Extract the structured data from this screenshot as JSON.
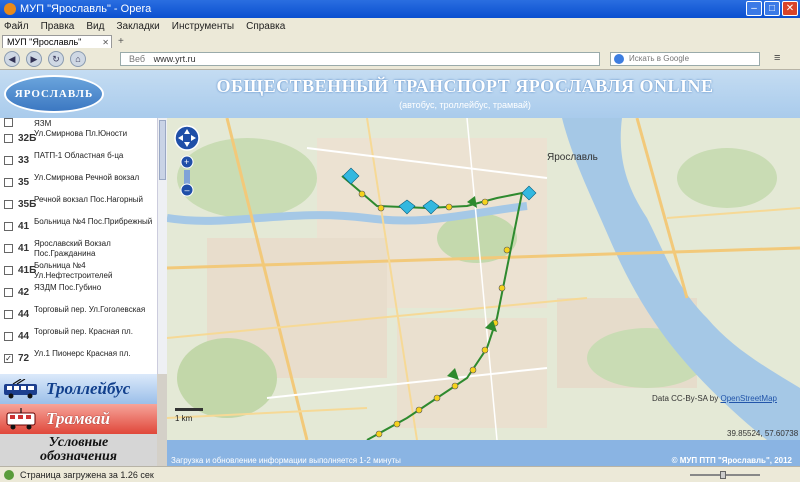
{
  "window": {
    "title": "МУП \"Ярославль\" - Opera"
  },
  "menu": [
    "Файл",
    "Правка",
    "Вид",
    "Закладки",
    "Инструменты",
    "Справка"
  ],
  "tab": {
    "label": "МУП \"Ярославль\""
  },
  "address_bar": {
    "prefix": "Веб",
    "url": "www.yrt.ru"
  },
  "search_bar": {
    "placeholder": "Искать в Google"
  },
  "header": {
    "logo": "ЯРОСЛАВЛЬ",
    "title": "ОБЩЕСТВЕННЫЙ ТРАНСПОРТ ЯРОСЛАВЛЯ ONLINE",
    "subtitle": "(автобус, троллейбус, трамвай)"
  },
  "routes": [
    {
      "num": "",
      "name": "ЯЗМ",
      "checked": false
    },
    {
      "num": "32Б",
      "name": "Ул.Смирнова Пл.Юности",
      "checked": false
    },
    {
      "num": "33",
      "name": "ПАТП-1 Областная б-ца",
      "checked": false
    },
    {
      "num": "35",
      "name": "Ул.Смирнова Речной вокзал",
      "checked": false
    },
    {
      "num": "35Б",
      "name": "Речной вокзал Пос.Нагорный",
      "checked": false
    },
    {
      "num": "41",
      "name": "Больница №4 Пос.Прибрежный",
      "checked": false
    },
    {
      "num": "41",
      "name": "Ярославский Вокзал Пос.Гражданина",
      "checked": false
    },
    {
      "num": "41Б",
      "name": "Больница №4 Ул.Нефтестроителей",
      "checked": false
    },
    {
      "num": "42",
      "name": "ЯЗДМ Пос.Губино",
      "checked": false
    },
    {
      "num": "44",
      "name": "Торговый пер. Ул.Гоголевская",
      "checked": false
    },
    {
      "num": "44",
      "name": "Торговый пер. Красная пл.",
      "checked": false
    },
    {
      "num": "72",
      "name": "Ул.1 Пионерс Красная пл.",
      "checked": true
    }
  ],
  "buttons": {
    "trolleybus": "Троллейбус",
    "tram": "Трамвай",
    "legend": "Условные обозначения"
  },
  "map": {
    "city_label": "Ярославль",
    "scale": "1 km",
    "attribution_prefix": "Data CC-By-SA by",
    "attribution_link": "OpenStreetMap",
    "coords": "39.85524, 57.60738"
  },
  "footer": {
    "left": "Загрузка и обновление информации выполняется 1-2 минуты",
    "right": "© МУП ПТП \"Ярославль\", 2012"
  },
  "status": {
    "text": "Страница загружена за 1.26 сек"
  },
  "colors": {
    "route_green": "#2e8a2e",
    "stop_yellow": "#f5d21c",
    "water": "#a5c8e6",
    "header_bg": "#b7d3ef",
    "tram_red": "#e0473a"
  }
}
